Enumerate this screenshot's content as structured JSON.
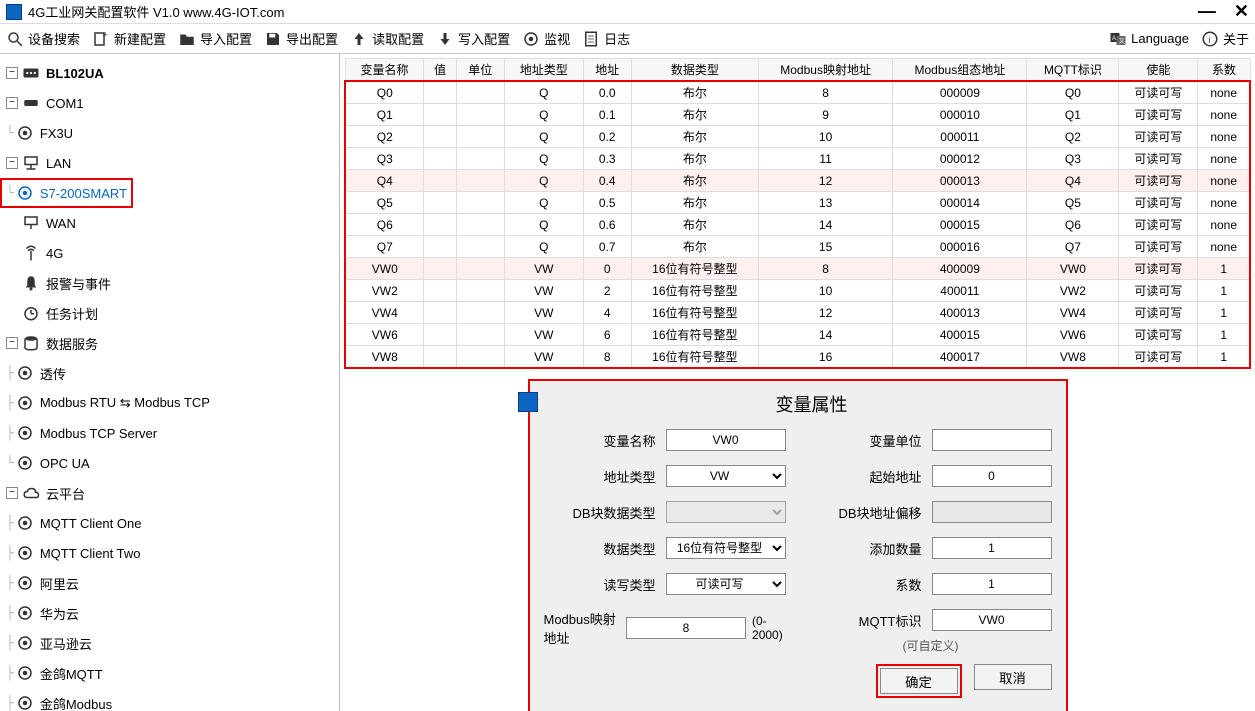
{
  "title": "4G工业网关配置软件 V1.0 www.4G-IOT.com",
  "toolbar": {
    "search": "设备搜索",
    "new": "新建配置",
    "import": "导入配置",
    "export": "导出配置",
    "read": "读取配置",
    "write": "写入配置",
    "monitor": "监视",
    "log": "日志",
    "language": "Language",
    "about": "关于"
  },
  "tree": {
    "root": "BL102UA",
    "com1": "COM1",
    "fx3u": "FX3U",
    "lan": "LAN",
    "s7": "S7-200SMART",
    "wan": "WAN",
    "g4": "4G",
    "alarm": "报警与事件",
    "task": "任务计划",
    "dataservice": "数据服务",
    "pass": "透传",
    "modbusrtu": "Modbus RTU ⇆ Modbus TCP",
    "modbustcp": "Modbus TCP Server",
    "opcua": "OPC UA",
    "cloud": "云平台",
    "mqtt1": "MQTT Client One",
    "mqtt2": "MQTT Client Two",
    "ali": "阿里云",
    "huawei": "华为云",
    "aws": "亚马逊云",
    "jinge": "金鸽MQTT",
    "jingeModbus": "金鸽Modbus"
  },
  "table": {
    "headers": [
      "变量名称",
      "值",
      "单位",
      "地址类型",
      "地址",
      "数据类型",
      "Modbus映射地址",
      "Modbus组态地址",
      "MQTT标识",
      "使能",
      "系数"
    ],
    "rows": [
      {
        "hl": false,
        "c": [
          "Q0",
          "",
          "",
          "Q",
          "0.0",
          "布尔",
          "8",
          "000009",
          "Q0",
          "可读可写",
          "none"
        ]
      },
      {
        "hl": false,
        "c": [
          "Q1",
          "",
          "",
          "Q",
          "0.1",
          "布尔",
          "9",
          "000010",
          "Q1",
          "可读可写",
          "none"
        ]
      },
      {
        "hl": false,
        "c": [
          "Q2",
          "",
          "",
          "Q",
          "0.2",
          "布尔",
          "10",
          "000011",
          "Q2",
          "可读可写",
          "none"
        ]
      },
      {
        "hl": false,
        "c": [
          "Q3",
          "",
          "",
          "Q",
          "0.3",
          "布尔",
          "11",
          "000012",
          "Q3",
          "可读可写",
          "none"
        ]
      },
      {
        "hl": true,
        "c": [
          "Q4",
          "",
          "",
          "Q",
          "0.4",
          "布尔",
          "12",
          "000013",
          "Q4",
          "可读可写",
          "none"
        ]
      },
      {
        "hl": false,
        "c": [
          "Q5",
          "",
          "",
          "Q",
          "0.5",
          "布尔",
          "13",
          "000014",
          "Q5",
          "可读可写",
          "none"
        ]
      },
      {
        "hl": false,
        "c": [
          "Q6",
          "",
          "",
          "Q",
          "0.6",
          "布尔",
          "14",
          "000015",
          "Q6",
          "可读可写",
          "none"
        ]
      },
      {
        "hl": false,
        "c": [
          "Q7",
          "",
          "",
          "Q",
          "0.7",
          "布尔",
          "15",
          "000016",
          "Q7",
          "可读可写",
          "none"
        ]
      },
      {
        "hl": true,
        "c": [
          "VW0",
          "",
          "",
          "VW",
          "0",
          "16位有符号整型",
          "8",
          "400009",
          "VW0",
          "可读可写",
          "1"
        ]
      },
      {
        "hl": false,
        "c": [
          "VW2",
          "",
          "",
          "VW",
          "2",
          "16位有符号整型",
          "10",
          "400011",
          "VW2",
          "可读可写",
          "1"
        ]
      },
      {
        "hl": false,
        "c": [
          "VW4",
          "",
          "",
          "VW",
          "4",
          "16位有符号整型",
          "12",
          "400013",
          "VW4",
          "可读可写",
          "1"
        ]
      },
      {
        "hl": false,
        "c": [
          "VW6",
          "",
          "",
          "VW",
          "6",
          "16位有符号整型",
          "14",
          "400015",
          "VW6",
          "可读可写",
          "1"
        ]
      },
      {
        "hl": false,
        "c": [
          "VW8",
          "",
          "",
          "VW",
          "8",
          "16位有符号整型",
          "16",
          "400017",
          "VW8",
          "可读可写",
          "1"
        ]
      }
    ]
  },
  "dialog": {
    "title": "变量属性",
    "labels": {
      "varname": "变量名称",
      "addrtype": "地址类型",
      "dbdatatype": "DB块数据类型",
      "datatype": "数据类型",
      "rwtype": "读写类型",
      "modbusmap": "Modbus映射地址",
      "modbusmapHint": "(0-2000)",
      "unit": "变量单位",
      "startaddr": "起始地址",
      "dboffset": "DB块地址偏移",
      "addcount": "添加数量",
      "coef": "系数",
      "mqttid": "MQTT标识",
      "mqttHint": "(可自定义)"
    },
    "values": {
      "varname": "VW0",
      "addrtype": "VW",
      "dbdatatype": "",
      "datatype": "16位有符号整型",
      "rwtype": "可读可写",
      "modbusmap": "8",
      "unit": "",
      "startaddr": "0",
      "dboffset": "",
      "addcount": "1",
      "coef": "1",
      "mqttid": "VW0"
    },
    "ok": "确定",
    "cancel": "取消"
  }
}
